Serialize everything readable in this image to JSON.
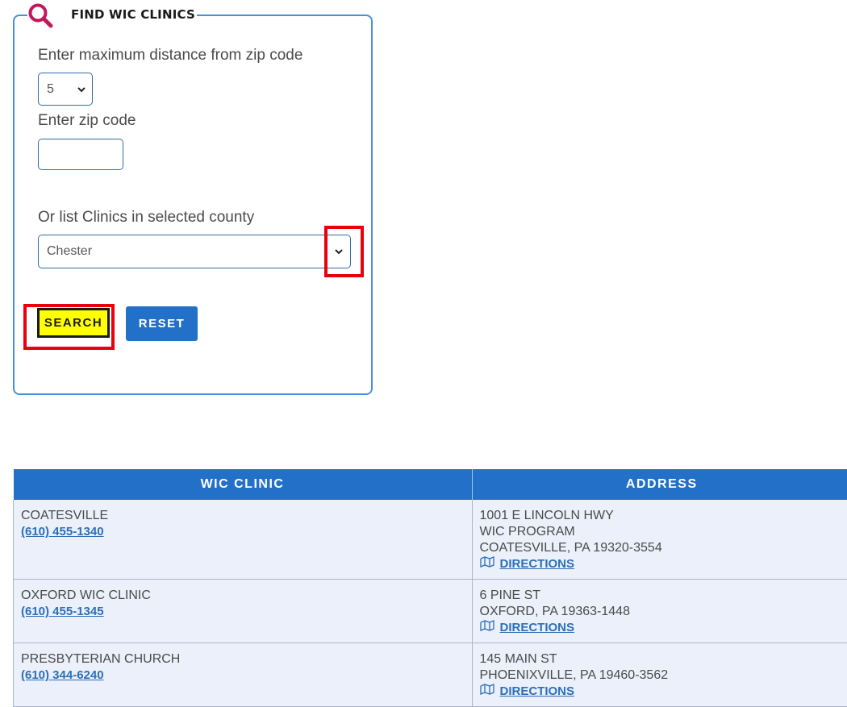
{
  "search_panel": {
    "title": "FIND WIC CLINICS",
    "distance_label": "Enter maximum distance from zip code",
    "distance_value": "5",
    "zip_label": "Enter zip code",
    "zip_value": "",
    "county_label": "Or list Clinics in selected county",
    "county_value": "Chester",
    "search_label": "SEARCH",
    "reset_label": "RESET"
  },
  "table": {
    "headers": [
      "WIC CLINIC",
      "ADDRESS"
    ],
    "rows": [
      {
        "name": "COATESVILLE",
        "phone": "(610) 455-1340",
        "address": [
          "1001 E LINCOLN HWY",
          "WIC PROGRAM",
          "COATESVILLE, PA 19320-3554"
        ],
        "directions": "DIRECTIONS"
      },
      {
        "name": "OXFORD WIC CLINIC",
        "phone": "(610) 455-1345",
        "address": [
          "6 PINE ST",
          "OXFORD, PA 19363-1448"
        ],
        "directions": "DIRECTIONS"
      },
      {
        "name": "PRESBYTERIAN CHURCH",
        "phone": "(610) 344-6240",
        "address": [
          "145 MAIN ST",
          "PHOENIXVILLE, PA 19460-3562"
        ],
        "directions": "DIRECTIONS"
      }
    ]
  },
  "colors": {
    "accent_blue": "#2270c8",
    "search_yellow": "#ffff00",
    "highlight_red": "#e8000b",
    "icon_magenta": "#c2185b"
  }
}
